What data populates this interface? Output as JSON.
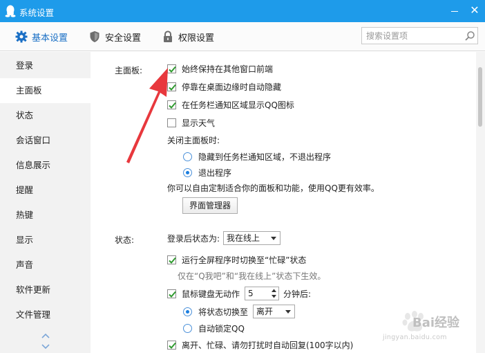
{
  "window": {
    "title": "系统设置",
    "close_glyph": "✕"
  },
  "tabs": [
    {
      "label": "基本设置",
      "icon": "gear-icon",
      "active": true
    },
    {
      "label": "安全设置",
      "icon": "shield-icon",
      "active": false
    },
    {
      "label": "权限设置",
      "icon": "lock-icon",
      "active": false
    }
  ],
  "search": {
    "placeholder": "搜索设置项",
    "value": ""
  },
  "sidebar": {
    "items": [
      {
        "label": "登录"
      },
      {
        "label": "主面板",
        "active": true
      },
      {
        "label": "状态"
      },
      {
        "label": "会话窗口"
      },
      {
        "label": "信息展示"
      },
      {
        "label": "提醒"
      },
      {
        "label": "热键"
      },
      {
        "label": "显示"
      },
      {
        "label": "声音"
      },
      {
        "label": "软件更新"
      },
      {
        "label": "文件管理"
      }
    ]
  },
  "main_panel": {
    "label": "主面板:",
    "options": [
      {
        "label": "始终保持在其他窗口前端",
        "checked": true
      },
      {
        "label": "停靠在桌面边缘时自动隐藏",
        "checked": true
      },
      {
        "label": "在任务栏通知区域显示QQ图标",
        "checked": true
      },
      {
        "label": "显示天气",
        "checked": false
      }
    ],
    "close_label": "关闭主面板时:",
    "close_options": [
      {
        "label": "隐藏到任务栏通知区域，不退出程序",
        "selected": false
      },
      {
        "label": "退出程序",
        "selected": true
      }
    ],
    "custom_hint": "你可以自由定制适合你的面板和功能，使用QQ更有效率。",
    "manager_button": "界面管理器"
  },
  "status": {
    "label": "状态:",
    "after_login_label": "登录后状态为:",
    "after_login_value": "我在线上",
    "fullscreen_option": {
      "label": "运行全屏程序时切换至“忙碌”状态",
      "checked": true
    },
    "fullscreen_note": "仅在“Q我吧”和“我在线上”状态下生效。",
    "idle_option": {
      "label": "鼠标键盘无动作",
      "checked": true
    },
    "idle_minutes": "5",
    "idle_suffix": "分钟后:",
    "idle_actions": [
      {
        "label": "将状态切换至",
        "selected": true
      },
      {
        "label": "自动锁定QQ",
        "selected": false
      }
    ],
    "switch_value": "离开",
    "auto_reply_option": {
      "label": "离开、忙碌、请勿打扰时自动回复(100字以内)",
      "checked": true
    }
  },
  "watermark": {
    "brand": "Bai",
    "brand_suffix": "经验",
    "url": "jingyan.baidu.com"
  },
  "colors": {
    "titlebar": "#1e9bea",
    "accent": "#1a6fc5",
    "check": "#2e9a2e",
    "arrow": "#e8383d"
  }
}
